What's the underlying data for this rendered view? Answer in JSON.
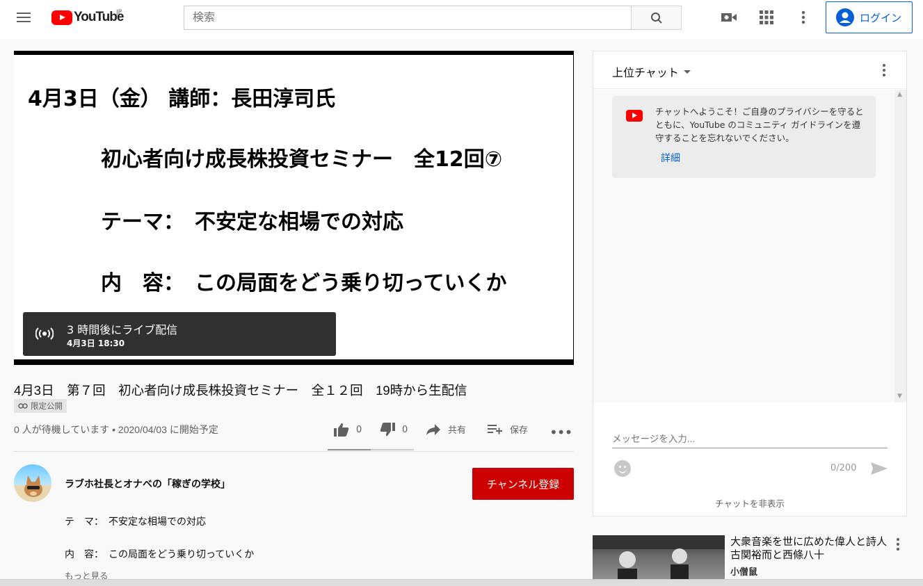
{
  "header": {
    "logo_text": "YouTube",
    "country": "JP",
    "search_placeholder": "検索",
    "login_label": "ログイン"
  },
  "player": {
    "slide_lines": [
      "4月3日（金） 講師：長田淳司氏",
      "初心者向け成長株投資セミナー　全12回⑦",
      "テーマ：　不安定な相場での対応",
      "内　容：　この局面をどう乗り切っていくか"
    ],
    "live_banner_text": "3 時間後にライブ配信",
    "live_banner_date": "4月3日 18:30"
  },
  "video": {
    "title": "4月3日　第７回　初心者向け成長株投資セミナー　全１２回　19時から生配信",
    "privacy_label": "限定公開",
    "meta": "0 人が待機しています • 2020/04/03 に開始予定",
    "like_count": "0",
    "dislike_count": "0",
    "share_label": "共有",
    "save_label": "保存",
    "like_ratio": 0.5
  },
  "channel": {
    "name": "ラブホ社長とオナベの「稼ぎの学校」",
    "subscribe_label": "チャンネル登録"
  },
  "description": {
    "line1": "テ　マ：　不安定な相場での対応",
    "line2": "内　容：　この局面をどう乗り切っていくか",
    "show_more": "もっと見る"
  },
  "chat": {
    "mode_label": "上位チャット",
    "welcome_text": "チャットへようこそ！ご自身のプライバシーを守るとともに、YouTube のコミュニティ ガイドラインを遵守することを忘れないでください。",
    "welcome_link": "詳細",
    "input_placeholder": "メッセージを入力...",
    "char_count": "0/200",
    "hide_label": "チャットを非表示"
  },
  "related": {
    "title": "大衆音楽を世に広めた偉人と詩人　古関裕而と西條八十",
    "channel": "小僧鼠"
  },
  "colors": {
    "brand_red": "#ff0000",
    "subscribe_red": "#cc0000",
    "link_blue": "#065fd4"
  }
}
